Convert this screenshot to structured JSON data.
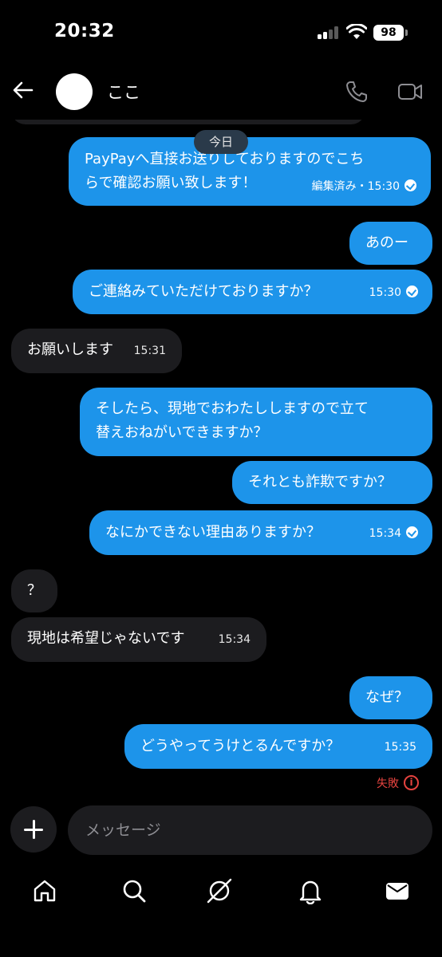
{
  "status_bar": {
    "time": "20:32",
    "battery": "98"
  },
  "header": {
    "contact_name": "ここ"
  },
  "date_divider": "今日",
  "messages": [
    {
      "side": "out",
      "lines": [
        "PayPayへ直接お送りしておりますのでこち",
        "らで確認お願い致します！"
      ],
      "meta": "編集済み・15:30",
      "check": true
    },
    {
      "side": "out",
      "lines": [
        "あのー"
      ],
      "meta": "",
      "check": false
    },
    {
      "side": "out",
      "lines": [
        "ご連絡みていただけておりますか？"
      ],
      "meta": "15:30",
      "check": true
    },
    {
      "side": "in",
      "lines": [
        "お願いします"
      ],
      "meta": "15:31",
      "check": false
    },
    {
      "side": "out",
      "lines": [
        "そしたら、現地でおわたししますので立て",
        "替えおねがいできますか？"
      ],
      "meta": "",
      "check": false
    },
    {
      "side": "out",
      "lines": [
        "それとも詐欺ですか？"
      ],
      "meta": "",
      "check": false
    },
    {
      "side": "out",
      "lines": [
        "なにかできない理由ありますか？"
      ],
      "meta": "15:34",
      "check": true
    },
    {
      "side": "in",
      "lines": [
        "？"
      ],
      "meta": "",
      "check": false
    },
    {
      "side": "in",
      "lines": [
        "現地は希望じゃないです"
      ],
      "meta": "15:34",
      "check": false
    },
    {
      "side": "out",
      "lines": [
        "なぜ？"
      ],
      "meta": "",
      "check": false
    },
    {
      "side": "out",
      "lines": [
        "どうやってうけとるんですか？"
      ],
      "meta": "15:35",
      "check": false
    }
  ],
  "failed_label": "失敗",
  "composer": {
    "placeholder": "メッセージ"
  },
  "icons": {
    "back": "arrow-left-icon",
    "call": "phone-icon",
    "video": "video-camera-icon",
    "add": "plus-icon",
    "failed": "info-circle-icon",
    "tabs": [
      "home-icon",
      "search-icon",
      "explore-icon",
      "bell-icon",
      "mail-icon"
    ]
  },
  "colors": {
    "outgoing_bubble": "#1d94ea",
    "incoming_bubble": "#1c1c1f",
    "failed": "#e5433f"
  }
}
